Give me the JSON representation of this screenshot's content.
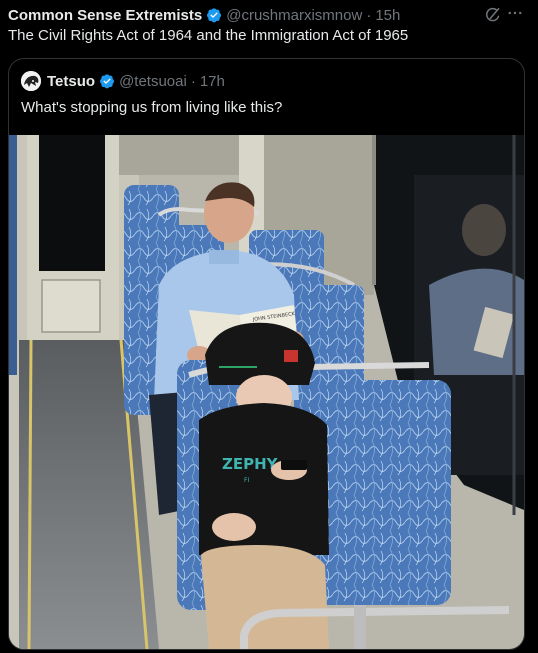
{
  "tweet": {
    "author_name": "Common Sense Extremists",
    "handle": "@crushmarxismnow",
    "separator": "·",
    "time": "15h",
    "text": "The Civil Rights Act of 1964 and the Immigration Act of 1965"
  },
  "quoted": {
    "author_name": "Tetsuo",
    "handle": "@tetsuoai",
    "separator": "·",
    "time": "17h",
    "text": "What's stopping us from living like this?"
  },
  "photo": {
    "book_cover_text": "JOHN STEINBECK",
    "shirt_text": "ZEPHY",
    "shirt_subtext": "FI"
  },
  "colors": {
    "background": "#000000",
    "text_primary": "#e7e9ea",
    "text_secondary": "#71767b",
    "verified_blue": "#1d9bf0",
    "seat_blue": "#4a78b8"
  },
  "icons": [
    "verified-badge-icon",
    "grok-icon",
    "more-options-icon"
  ]
}
